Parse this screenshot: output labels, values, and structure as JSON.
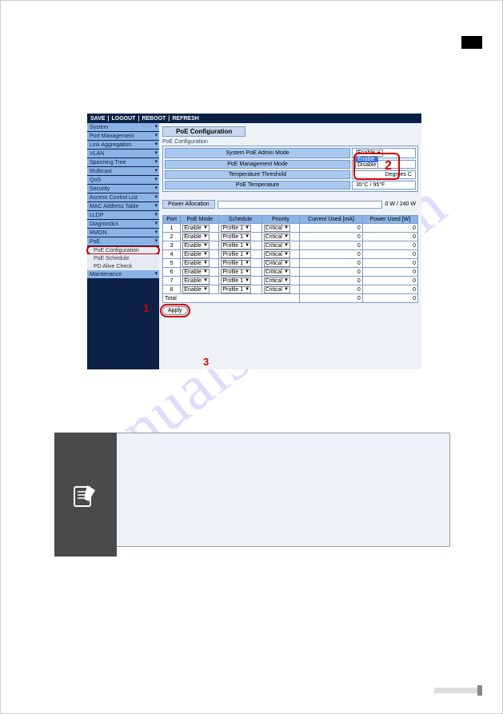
{
  "watermark": "manualshive.com",
  "topbar": [
    "SAVE",
    "LOGOUT",
    "REBOOT",
    "REFRESH"
  ],
  "sidebar": {
    "items": [
      {
        "label": "System"
      },
      {
        "label": "Port Management"
      },
      {
        "label": "Link Aggregation"
      },
      {
        "label": "VLAN"
      },
      {
        "label": "Spanning Tree"
      },
      {
        "label": "Multicast"
      },
      {
        "label": "QoS"
      },
      {
        "label": "Security"
      },
      {
        "label": "Access Control List"
      },
      {
        "label": "MAC Address Table"
      },
      {
        "label": "LLDP"
      },
      {
        "label": "Diagnostics"
      },
      {
        "label": "RMON"
      },
      {
        "label": "PoE"
      }
    ],
    "sub": [
      {
        "label": "PoE Configuration"
      },
      {
        "label": "PoE Schedule"
      },
      {
        "label": "PD Alive Check"
      }
    ],
    "last": {
      "label": "Maintenance"
    }
  },
  "page_title": "PoE Configuration",
  "section_label": "PoE Configuration",
  "cfg": {
    "r1": {
      "label": "System PoE Admin Mode",
      "value": "Enable"
    },
    "r2": {
      "label": "PoE Management Mode",
      "value": ""
    },
    "r3": {
      "label": "Temperature Threshold",
      "value": "",
      "unit": "Degrees C"
    },
    "r4": {
      "label": "PoE Temperature",
      "value": "35°C / 95°F"
    },
    "dropdown": {
      "opt1": "Enable",
      "opt2": "Disable"
    }
  },
  "alloc": {
    "label": "Power Allocation",
    "text": "0 W / 240 W"
  },
  "table": {
    "headers": [
      "Port",
      "PoE Mode",
      "Schedule",
      "Priority",
      "Current Used [mA]",
      "Power Used [W]"
    ],
    "rows": [
      {
        "port": "1",
        "mode": "Enable",
        "sched": "Profile 1",
        "prio": "Critical",
        "ma": "0",
        "pw": "0"
      },
      {
        "port": "2",
        "mode": "Enable",
        "sched": "Profile 1",
        "prio": "Critical",
        "ma": "0",
        "pw": "0"
      },
      {
        "port": "3",
        "mode": "Enable",
        "sched": "Profile 1",
        "prio": "Critical",
        "ma": "0",
        "pw": "0"
      },
      {
        "port": "4",
        "mode": "Enable",
        "sched": "Profile 1",
        "prio": "Critical",
        "ma": "0",
        "pw": "0"
      },
      {
        "port": "5",
        "mode": "Enable",
        "sched": "Profile 1",
        "prio": "Critical",
        "ma": "0",
        "pw": "0"
      },
      {
        "port": "6",
        "mode": "Enable",
        "sched": "Profile 1",
        "prio": "Critical",
        "ma": "0",
        "pw": "0"
      },
      {
        "port": "7",
        "mode": "Enable",
        "sched": "Profile 1",
        "prio": "Critical",
        "ma": "0",
        "pw": "0"
      },
      {
        "port": "8",
        "mode": "Enable",
        "sched": "Profile 1",
        "prio": "Critical",
        "ma": "0",
        "pw": "0"
      }
    ],
    "total_label": "Total",
    "total_ma": "0",
    "total_pw": "0"
  },
  "apply": "Apply",
  "annotations": {
    "one": "1",
    "two": "2",
    "three": "3"
  }
}
